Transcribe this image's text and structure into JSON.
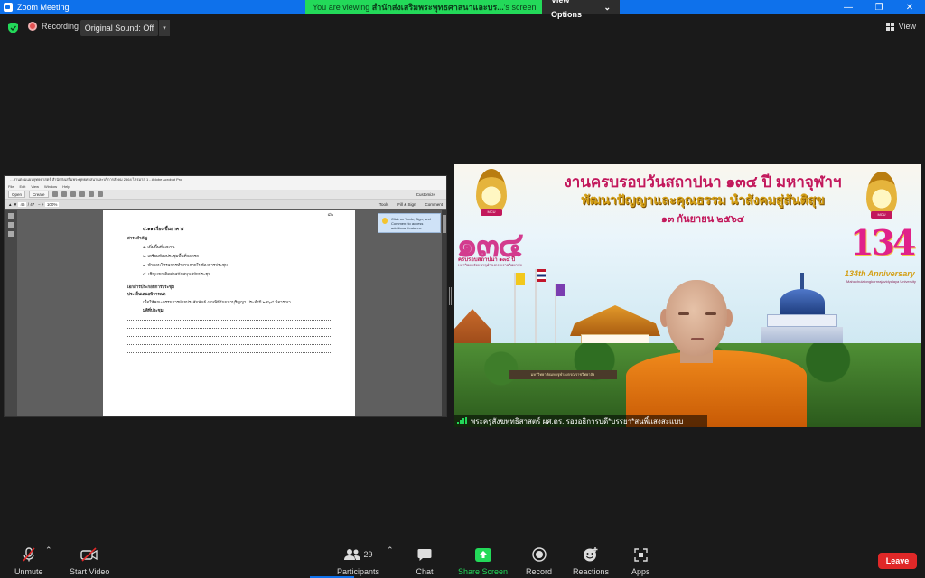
{
  "window": {
    "title": "Zoom Meeting",
    "viewing_prefix": "You are viewing ",
    "viewing_name": "สำนักส่งเสริมพระพุทธศาสนาและบร...",
    "viewing_suffix": "'s screen",
    "view_options": "View Options",
    "controls": [
      "—",
      "❐",
      "✕"
    ]
  },
  "topbar": {
    "recording": "Recording",
    "original_sound": "Original Sound: Off",
    "view": "View"
  },
  "pdf": {
    "window_title": "…งานตามแผนยุทธศาสตร์ สำนักส่งเสริมพระพุทธศาสนาและบริการสังคม 2564 ไตรมาส 1 - Adobe Acrobat Pro",
    "menu": [
      "File",
      "Edit",
      "View",
      "Window",
      "Help"
    ],
    "toolbar_open": "Open",
    "toolbar_create": "Create",
    "customize": "Customize",
    "page_current": "46",
    "page_total": "/ 47",
    "zoom": "100%",
    "tabs": [
      "Tools",
      "Fill & Sign",
      "Comment"
    ],
    "side_panel_text": "Click on Tools, Sign, and Comment to access additional features.",
    "page_corner": "๔๒",
    "heading": "๕.๑๑ เรื่อง ขึ้นอาคาร",
    "section1": "สาระสำคัญ",
    "items": [
      "๑. เพิ่มพื้นที่ลงพาน",
      "๒. เตรียมห้องประชุมพื้นที่จอดรถ",
      "๓. ทำคอนโทรลการทำงานภายในห้องการประชุม",
      "๔. เชิญแขก ติดต่อสนับสนุนสมัยประชุม"
    ],
    "section2": "เอกสารประกอบการประชุม",
    "section3": "ประเด็นเสนอพิจารณา",
    "proposal": "เพื่อให้คณะกรรมการฝ่ายประสัมพันธ์ งานพิธีวันมหาบุริญญา ประจำปี ๒๕๖๔ พิจารณา",
    "resolution": "มติที่ประชุม"
  },
  "video": {
    "banner_line1": "งานครบรอบวันสถาปนา ๑๓๔ ปี มหาจุฬาฯ",
    "banner_line2": "พัฒนาปัญญาและคุณธรรม นำสังคมสู่สันติสุข",
    "banner_line3": "๑๓ กันยายน ๒๕๖๔",
    "logo_numerals": "๑๓๔",
    "logo_caption": "ครบรอบสถาปนา ๑๓๔ ปี",
    "logo_caption_sub": "มหาวิทยาลัยมหาจุฬาลงกรณราชวิทยาลัย",
    "num_134": "134",
    "anniversary": "134th Anniversary",
    "anniversary_sub": "Mahachulalongkornrajavidyalaya University",
    "emblem_label": "MCU",
    "signboard": "มหาวิทยาลัยมหาจุฬาลงกรณราชวิทยาลัย",
    "participant_name": "พระครูสังฆพุทธิสาสตร์ ผศ.ดร. รองอธิการบดี*บรรยา*สนพิ์แสงสะแบบ"
  },
  "toolbar": {
    "unmute": "Unmute",
    "start_video": "Start Video",
    "participants": "Participants",
    "participant_count": "29",
    "chat": "Chat",
    "share_screen": "Share Screen",
    "record": "Record",
    "reactions": "Reactions",
    "apps": "Apps",
    "leave": "Leave"
  },
  "colors": {
    "zoom_blue": "#0e71eb",
    "share_green": "#23d959",
    "leave_red": "#e02828",
    "background": "#1a1a1a"
  }
}
